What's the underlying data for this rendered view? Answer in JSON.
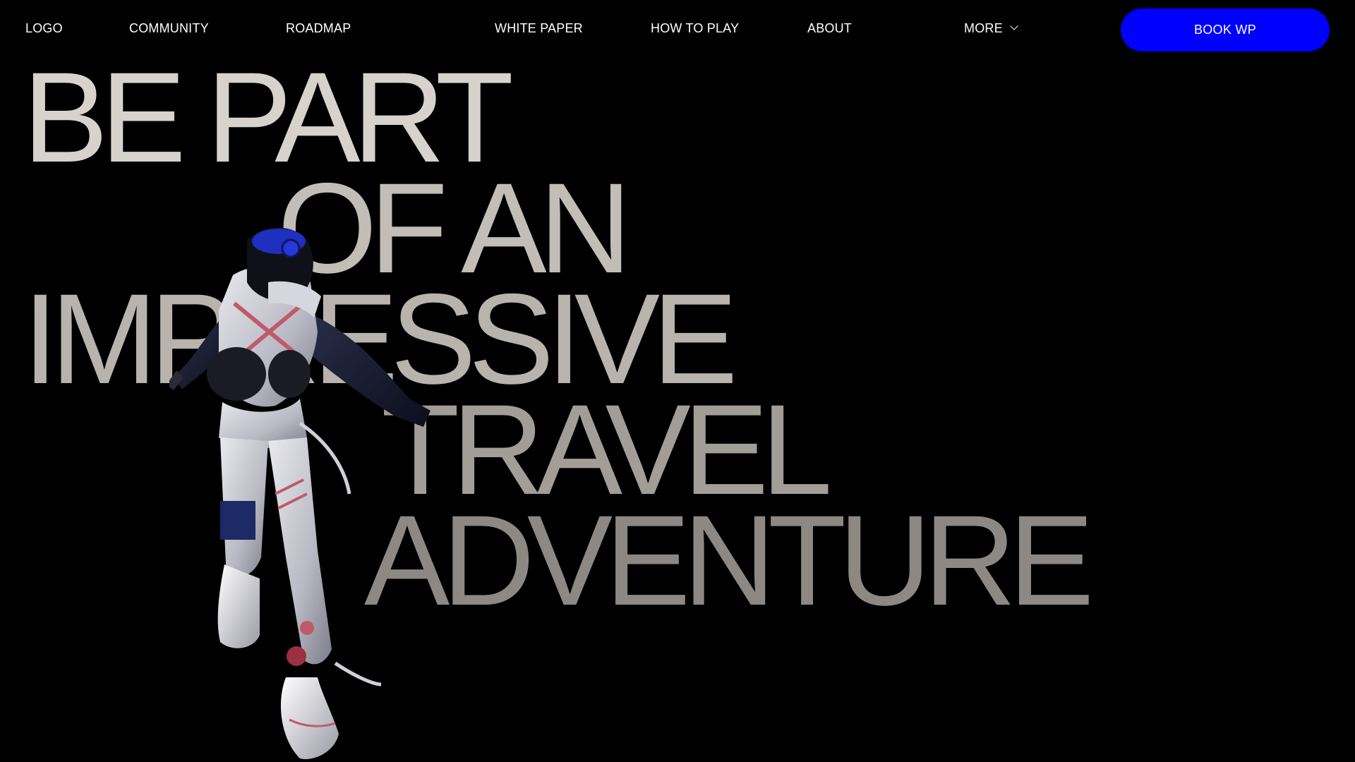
{
  "nav": {
    "logo": "LOGO",
    "items": [
      {
        "label": "COMMUNITY"
      },
      {
        "label": "ROADMAP"
      },
      {
        "label": "WHITE PAPER"
      },
      {
        "label": "HOW TO PLAY"
      },
      {
        "label": "ABOUT"
      },
      {
        "label": "MORE",
        "icon": "chevron-down-icon"
      }
    ],
    "cta": "BOOK WP"
  },
  "hero": {
    "lines": [
      "BE PART",
      "OF AN",
      "IMPRESSIVE",
      "TRAVEL",
      "ADVENTURE"
    ]
  },
  "colors": {
    "background": "#000000",
    "accent": "#0000ff",
    "nav_text": "#ffffff",
    "hero_text_top": "#d8d2cc",
    "hero_text_bottom": "#8d8884"
  },
  "media": {
    "character": "astronaut-character-3d-figure"
  }
}
